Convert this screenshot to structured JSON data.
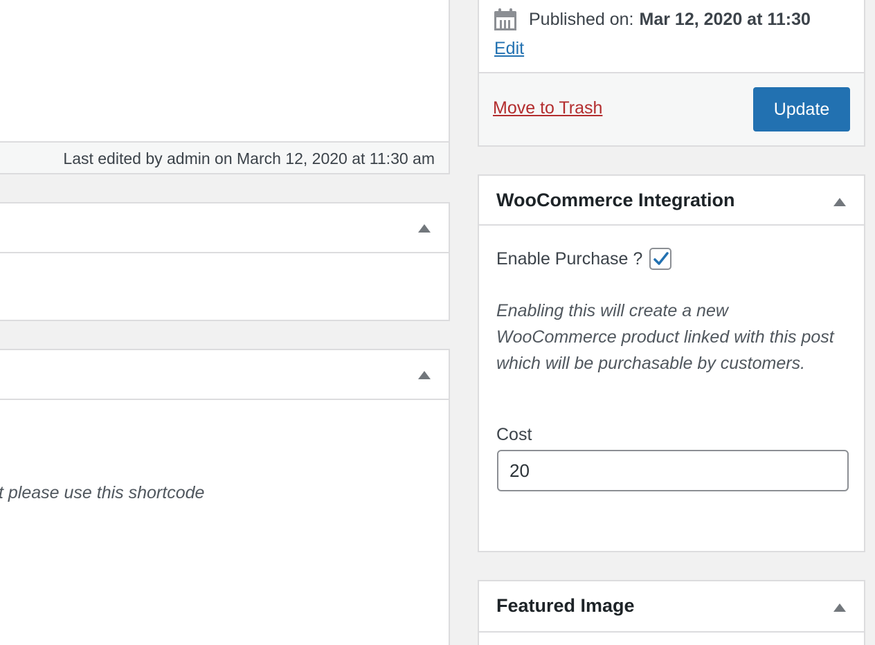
{
  "editor": {
    "last_edited": "Last edited by admin on March 12, 2020 at 11:30 am"
  },
  "metabox_shortcode": {
    "description": "t please use this shortcode"
  },
  "publish": {
    "published_label": "Published on:",
    "published_date": "Mar 12, 2020 at 11:30",
    "edit_label": "Edit",
    "trash_label": "Move to Trash",
    "update_label": "Update"
  },
  "woocommerce": {
    "title": "WooCommerce Integration",
    "enable_label": "Enable Purchase ?",
    "enable_checked": true,
    "description": "Enabling this will create a new WooCommerce product linked with this post which will be purchasable by customers.",
    "cost_label": "Cost",
    "cost_value": "20"
  },
  "featured_image": {
    "title": "Featured Image"
  },
  "colors": {
    "primary": "#2271b1",
    "danger": "#b32d2e",
    "border": "#dcdcde"
  }
}
